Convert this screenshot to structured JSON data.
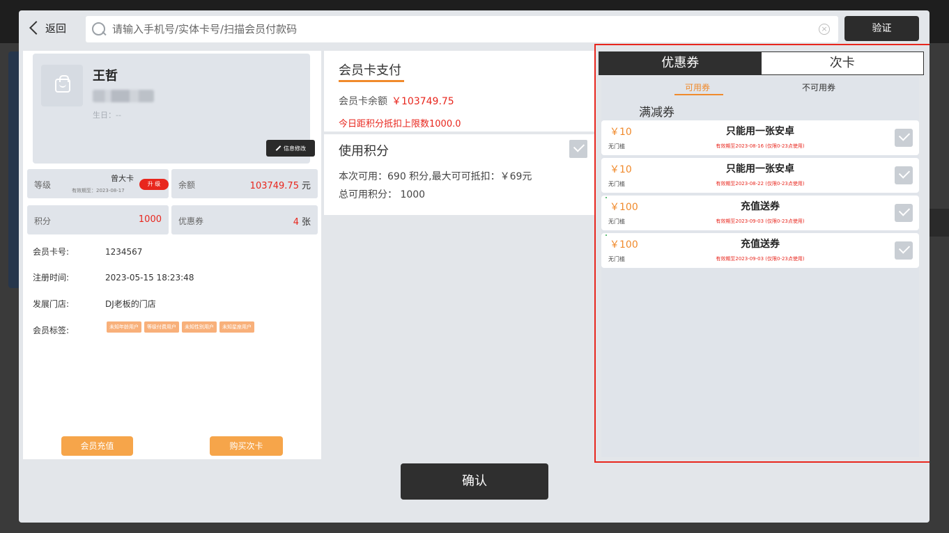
{
  "topbar": {
    "back_label": "返回",
    "search_placeholder": "请输入手机号/实体卡号/扫描会员付款码",
    "verify_label": "验证"
  },
  "member": {
    "name": "王哲",
    "birthday": "生日：--",
    "edit_label": "信息修改",
    "level_label": "等级",
    "card_name": "曾大卡",
    "expire": "有效期至：2023-08-17",
    "upgrade_label": "升 级",
    "balance_label": "余额",
    "balance_value": "103749.75",
    "balance_unit": "元",
    "points_label": "积分",
    "points_value": "1000",
    "coupons_label": "优惠券",
    "coupons_value": "4",
    "coupons_unit": "张",
    "details": [
      {
        "key": "会员卡号:",
        "value": "1234567"
      },
      {
        "key": "注册时间:",
        "value": "2023-05-15 18:23:48"
      },
      {
        "key": "发展门店:",
        "value": "DJ老板的门店"
      },
      {
        "key": "会员标签:",
        "value": ""
      }
    ],
    "tags": [
      "未知年龄用户",
      "等级付费用户",
      "未知性别用户",
      "未知星座用户"
    ],
    "recharge_label": "会员充值",
    "buy_card_label": "购买次卡"
  },
  "payment": {
    "title": "会员卡支付",
    "balance_label": "会员卡余额",
    "balance_amount": "￥103749.75",
    "limit_text": "今日距积分抵扣上限数1000.0",
    "points_title": "使用积分",
    "points_line1": "本次可用：690 积分,最大可可抵扣：￥69元",
    "points_line2": "总可用积分： 1000"
  },
  "confirm_label": "确认",
  "right_panel": {
    "tab_coupons": "优惠券",
    "tab_cards": "次卡",
    "sub_available": "可用券",
    "sub_unavailable": "不可用券",
    "group_title": "满减券",
    "coupons": [
      {
        "value": "￥10",
        "threshold": "无门槛",
        "name": "只能用一张安卓",
        "expire": "有效期至2023-08-16 (仅限0-23点使用)"
      },
      {
        "value": "￥10",
        "threshold": "无门槛",
        "name": "只能用一张安卓",
        "expire": "有效期至2023-08-22 (仅限0-23点使用)"
      },
      {
        "value": "￥100",
        "threshold": "无门槛",
        "name": "充值送券",
        "expire": "有效期至2023-09-03 (仅限0-23点使用)"
      },
      {
        "value": "￥100",
        "threshold": "无门槛",
        "name": "充值送券",
        "expire": "有效期至2023-09-03 (仅限0-23点使用)"
      }
    ]
  },
  "colors": {
    "accent_orange": "#f08a2c",
    "alert_red": "#e8261d",
    "dark_button": "#2f2f2f"
  }
}
